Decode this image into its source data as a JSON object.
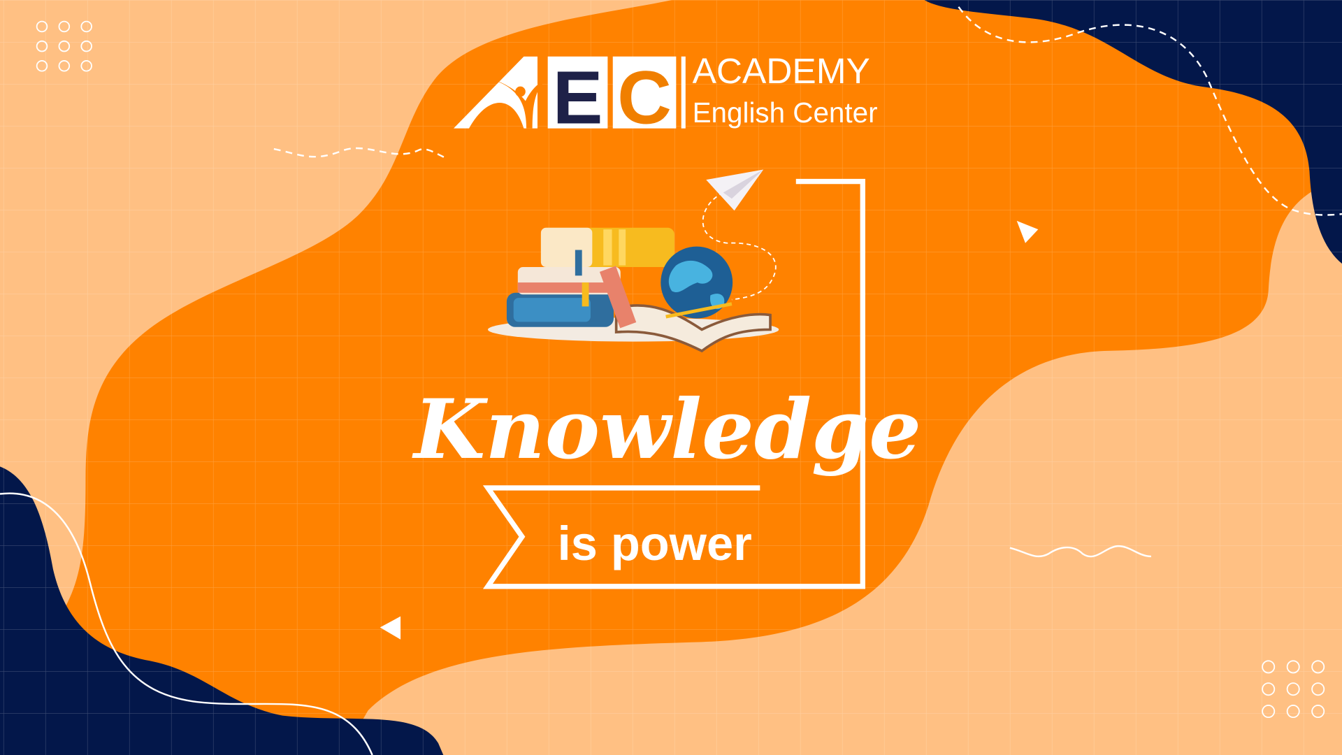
{
  "logo": {
    "mark_letters": [
      "E",
      "C"
    ],
    "name": "ACADEMY",
    "subtitle": "English Center"
  },
  "headline": {
    "script_word": "Knowledge",
    "banner_text": "is power"
  },
  "colors": {
    "peach": "#FFC083",
    "orange": "#FF8200",
    "navy": "#03174A",
    "white": "#FFFFFF"
  },
  "icons": [
    "books-stack-icon",
    "globe-icon",
    "paper-plane-icon"
  ]
}
